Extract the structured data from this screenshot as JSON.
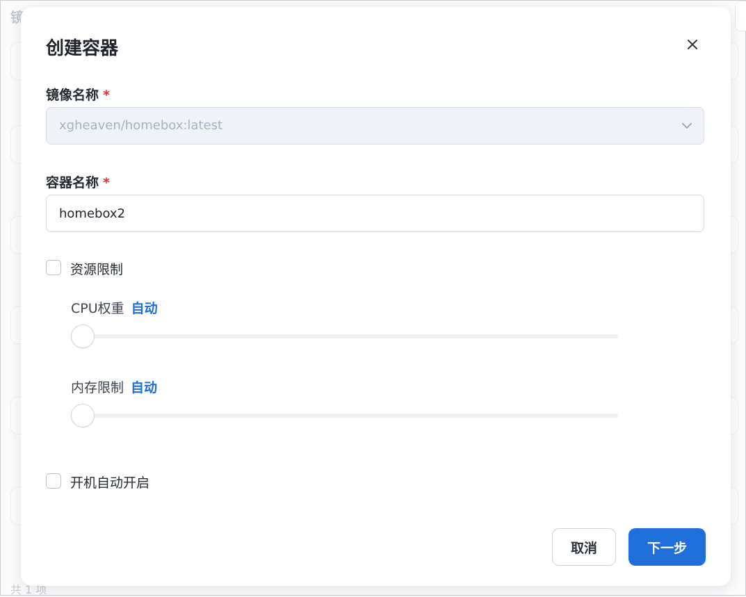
{
  "background": {
    "title": "镜",
    "footer": "共 1 项"
  },
  "modal": {
    "title": "创建容器",
    "close_icon": "close-icon",
    "image_field": {
      "label": "镜像名称",
      "required_mark": "*",
      "value": "xgheaven/homebox:latest",
      "disabled": true
    },
    "name_field": {
      "label": "容器名称",
      "required_mark": "*",
      "value": "homebox2"
    },
    "resource_limit": {
      "label": "资源限制",
      "checked": false,
      "cpu": {
        "label": "CPU权重",
        "value": "自动",
        "level": 0
      },
      "memory": {
        "label": "内存限制",
        "value": "自动",
        "level": 0
      }
    },
    "autostart": {
      "label": "开机自动开启",
      "checked": false
    },
    "buttons": {
      "cancel": "取消",
      "next": "下一步"
    }
  },
  "colors": {
    "accent": "#1e6fd9",
    "required": "#e03131",
    "disabled_bg": "#eff3f8"
  }
}
